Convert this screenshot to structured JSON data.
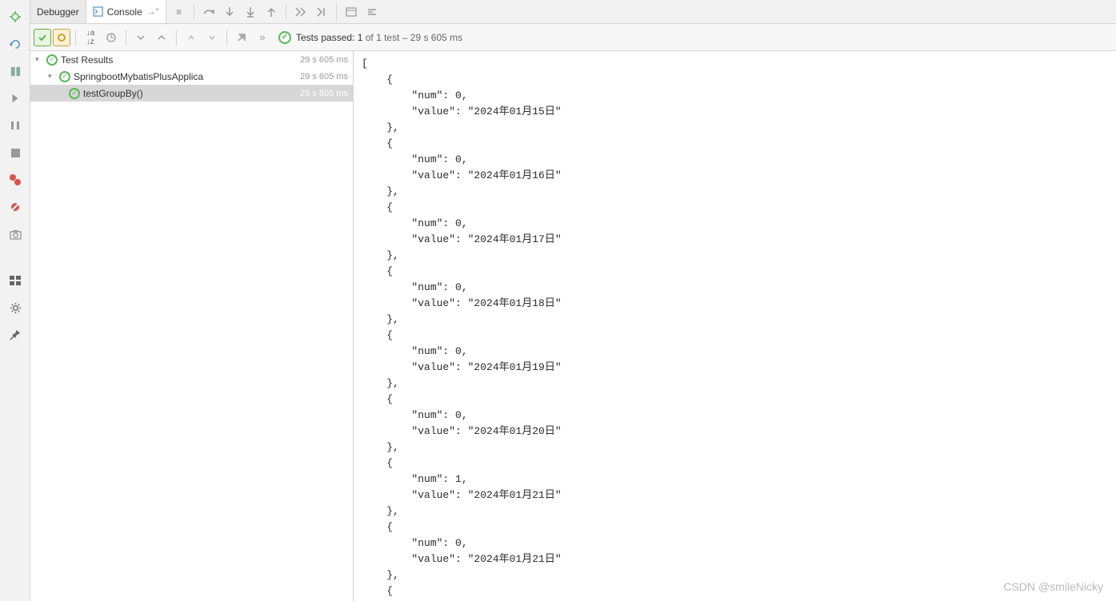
{
  "tabs": {
    "debugger": "Debugger",
    "console": "Console"
  },
  "tests": {
    "prefix": "Tests passed:",
    "passed_count": "1",
    "suffix": "of 1 test – 29 s 605 ms"
  },
  "tree": {
    "root": {
      "label": "Test Results",
      "time": "29 s 605 ms"
    },
    "suite": {
      "label": "SpringbootMybatisPlusApplica",
      "time": "29 s 605 ms"
    },
    "test": {
      "label": "testGroupBy()",
      "time": "29 s 605 ms"
    }
  },
  "console_output": [
    {
      "num": 0,
      "value": "2024年01月15日"
    },
    {
      "num": 0,
      "value": "2024年01月16日"
    },
    {
      "num": 0,
      "value": "2024年01月17日"
    },
    {
      "num": 0,
      "value": "2024年01月18日"
    },
    {
      "num": 0,
      "value": "2024年01月19日"
    },
    {
      "num": 0,
      "value": "2024年01月20日"
    },
    {
      "num": 1,
      "value": "2024年01月21日"
    },
    {
      "num": 0,
      "value": "2024年01月21日"
    }
  ],
  "watermark": "CSDN @smileNicky"
}
